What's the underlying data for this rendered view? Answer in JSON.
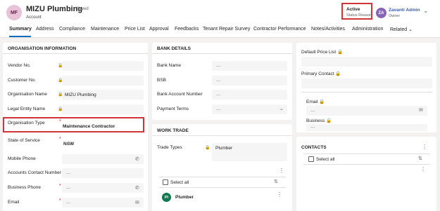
{
  "header": {
    "avatar_initials": "MF",
    "title": "MIZU Plumbing",
    "saved_status": "- Saved",
    "entity": "Account",
    "status_value": "Active",
    "status_label": "Status Reason",
    "owner_initials": "ZA",
    "owner_name": "Zavanti Admin",
    "owner_label": "Owner",
    "expand_icon": "chevron-down-icon"
  },
  "tabs": [
    "Summary",
    "Address",
    "Compliance",
    "Maintenance",
    "Price List",
    "Approval",
    "Feedbacks",
    "Tenant Repair Survey",
    "Contractor Performance",
    "Notes/Activities",
    "Administration",
    "Related"
  ],
  "organisation": {
    "section_title": "ORGANISATION INFORMATION",
    "vendor_no_label": "Vendor No.",
    "customer_no_label": "Customer No.",
    "org_name_label": "Organisation Name",
    "org_name_value": "MIZU Plumbing",
    "legal_entity_label": "Legal Entity Name",
    "org_type_label": "Organisation Type",
    "org_type_value": "Maintenance Contractor",
    "state_label": "State of Service",
    "state_value": "NSW",
    "mobile_label": "Mobile Phone",
    "accounts_contact_label": "Accounts Contact Number",
    "accounts_contact_value": "---",
    "business_phone_label": "Business Phone",
    "business_phone_value": "---",
    "email_label": "Email",
    "email_value": "---"
  },
  "bank": {
    "section_title": "BANK DETAILS",
    "bank_name_label": "Bank Name",
    "bank_name_value": "---",
    "bsb_label": "BSB",
    "bsb_value": "---",
    "account_no_label": "Bank Account Number",
    "account_no_value": "---",
    "payment_terms_label": "Payment Terms",
    "payment_terms_value": "---"
  },
  "work_trade": {
    "section_title": "WORK TRADE",
    "trade_types_label": "Trade Types",
    "trade_types_value": "Plumber",
    "select_all": "Select all",
    "items": [
      {
        "initials": "Pl",
        "name": "Plumber"
      }
    ]
  },
  "right": {
    "price_list_label": "Default Price List",
    "primary_contact_label": "Primary Contact",
    "email_label": "Email",
    "email_value": "---",
    "business_label": "Business",
    "business_value": "---",
    "contacts_title": "CONTACTS",
    "contacts_select_all": "Select all"
  },
  "colors": {
    "accent": "#0f6cbd",
    "highlight": "#d13438",
    "required": "#c50f1f"
  }
}
